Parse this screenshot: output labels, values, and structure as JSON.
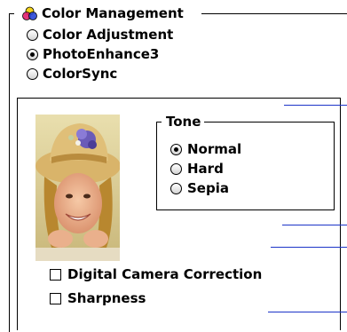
{
  "color_management": {
    "title": "Color Management",
    "icon": "color-management-icon",
    "options": [
      {
        "label": "Color Adjustment",
        "selected": false
      },
      {
        "label": "PhotoEnhance3",
        "selected": true
      },
      {
        "label": "ColorSync",
        "selected": false
      }
    ]
  },
  "photo": {
    "icon": "sample-photo-child-with-hat"
  },
  "tone": {
    "title": "Tone",
    "options": [
      {
        "label": "Normal",
        "selected": true
      },
      {
        "label": "Hard",
        "selected": false
      },
      {
        "label": "Sepia",
        "selected": false
      }
    ]
  },
  "checkboxes": [
    {
      "label": "Digital Camera Correction",
      "checked": false
    },
    {
      "label": "Sharpness",
      "checked": false
    }
  ],
  "colors": {
    "callout_line": "#1c34c8"
  }
}
